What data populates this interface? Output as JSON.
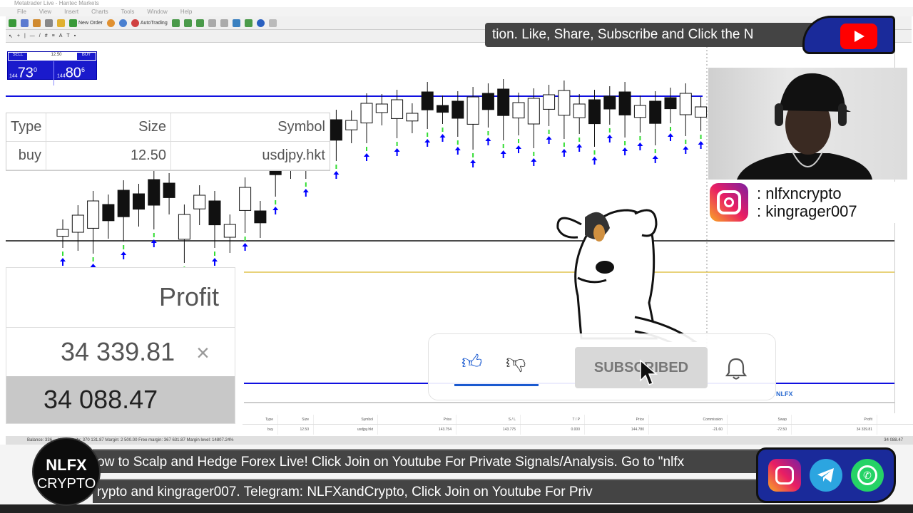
{
  "window": {
    "title": "Metatrader Live - Hantec Markets",
    "menu": [
      "File",
      "View",
      "Insert",
      "Charts",
      "Tools",
      "Window",
      "Help"
    ]
  },
  "toolbar": {
    "new_order": "New Order",
    "autotrading": "AutoTrading"
  },
  "one_click": {
    "sell_label": "SELL",
    "buy_label": "BUY",
    "lot": "12.50",
    "sell_prefix": "144",
    "sell_big": "73",
    "sell_sup": "0",
    "buy_prefix": "144",
    "buy_big": "80",
    "buy_sup": "6"
  },
  "overlay_table": {
    "headers": [
      "Type",
      "Size",
      "Symbol"
    ],
    "row": [
      "buy",
      "12.50",
      "usdjpy.hkt"
    ]
  },
  "profit_box": {
    "header": "Profit",
    "current": "34 339.81",
    "close_glyph": "×",
    "total": "34 088.47"
  },
  "terminal": {
    "headers": [
      "Type",
      "Size",
      "Symbol",
      "Price",
      "S / L",
      "T / P",
      "Price",
      "Commission",
      "Swap",
      "Profit"
    ],
    "row": [
      "buy",
      "12.50",
      "usdjpy.hkt",
      "143.754",
      "143.775",
      "0.000",
      "144.780",
      "-21.60",
      "-72.50",
      "34 339.81"
    ]
  },
  "chart": {
    "label": "NLFX"
  },
  "status": {
    "text": "Balance: 336 ... USD  Equity: 370 131.87  Margin: 2 500.00  Free margin: 367 631.87  Margin level: 14807.24%",
    "total": "34 088.47"
  },
  "ticker_top": {
    "text": "tion.  Like, Share, Subscribe and Click the N"
  },
  "ticker_1": {
    "text": "ow to Scalp and Hedge Forex Live! Click Join on Youtube For Private Signals/Analysis. Go to \"nlfx"
  },
  "ticker_2": {
    "text": "rypto and kingrager007.  Telegram: NLFXandCrypto,  Click Join on Youtube For Priv"
  },
  "logo": {
    "line1": "NLFX",
    "line2": "CRYPTO"
  },
  "instagram": {
    "handle1": ": nlfxncrypto",
    "handle2": ": kingrager007"
  },
  "subscribe": {
    "button": "SUBSCRIBED"
  },
  "colors": {
    "chart_blue": "#1010e0",
    "youtube_red": "#ff0000",
    "panel_blue": "#1a2a9a",
    "arrow_blue": "#0000ff",
    "arrow_green": "#33dd33"
  }
}
